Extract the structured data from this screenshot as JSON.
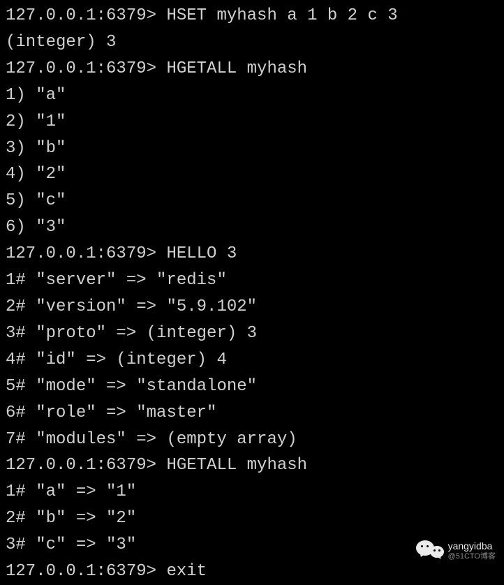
{
  "terminal": {
    "prompt": "127.0.0.1:6379> ",
    "lines": [
      {
        "type": "cmd",
        "text": "HSET myhash a 1 b 2 c 3"
      },
      {
        "type": "out",
        "text": "(integer) 3"
      },
      {
        "type": "cmd",
        "text": "HGETALL myhash"
      },
      {
        "type": "out",
        "text": "1) \"a\""
      },
      {
        "type": "out",
        "text": "2) \"1\""
      },
      {
        "type": "out",
        "text": "3) \"b\""
      },
      {
        "type": "out",
        "text": "4) \"2\""
      },
      {
        "type": "out",
        "text": "5) \"c\""
      },
      {
        "type": "out",
        "text": "6) \"3\""
      },
      {
        "type": "cmd",
        "text": "HELLO 3"
      },
      {
        "type": "out",
        "text": "1# \"server\" => \"redis\""
      },
      {
        "type": "out",
        "text": "2# \"version\" => \"5.9.102\""
      },
      {
        "type": "out",
        "text": "3# \"proto\" => (integer) 3"
      },
      {
        "type": "out",
        "text": "4# \"id\" => (integer) 4"
      },
      {
        "type": "out",
        "text": "5# \"mode\" => \"standalone\""
      },
      {
        "type": "out",
        "text": "6# \"role\" => \"master\""
      },
      {
        "type": "out",
        "text": "7# \"modules\" => (empty array)"
      },
      {
        "type": "cmd",
        "text": "HGETALL myhash"
      },
      {
        "type": "out",
        "text": "1# \"a\" => \"1\""
      },
      {
        "type": "out",
        "text": "2# \"b\" => \"2\""
      },
      {
        "type": "out",
        "text": "3# \"c\" => \"3\""
      },
      {
        "type": "cmd",
        "text": "exit"
      }
    ]
  },
  "watermark": {
    "name": "yangyidba",
    "sub": "@51CTO博客"
  }
}
